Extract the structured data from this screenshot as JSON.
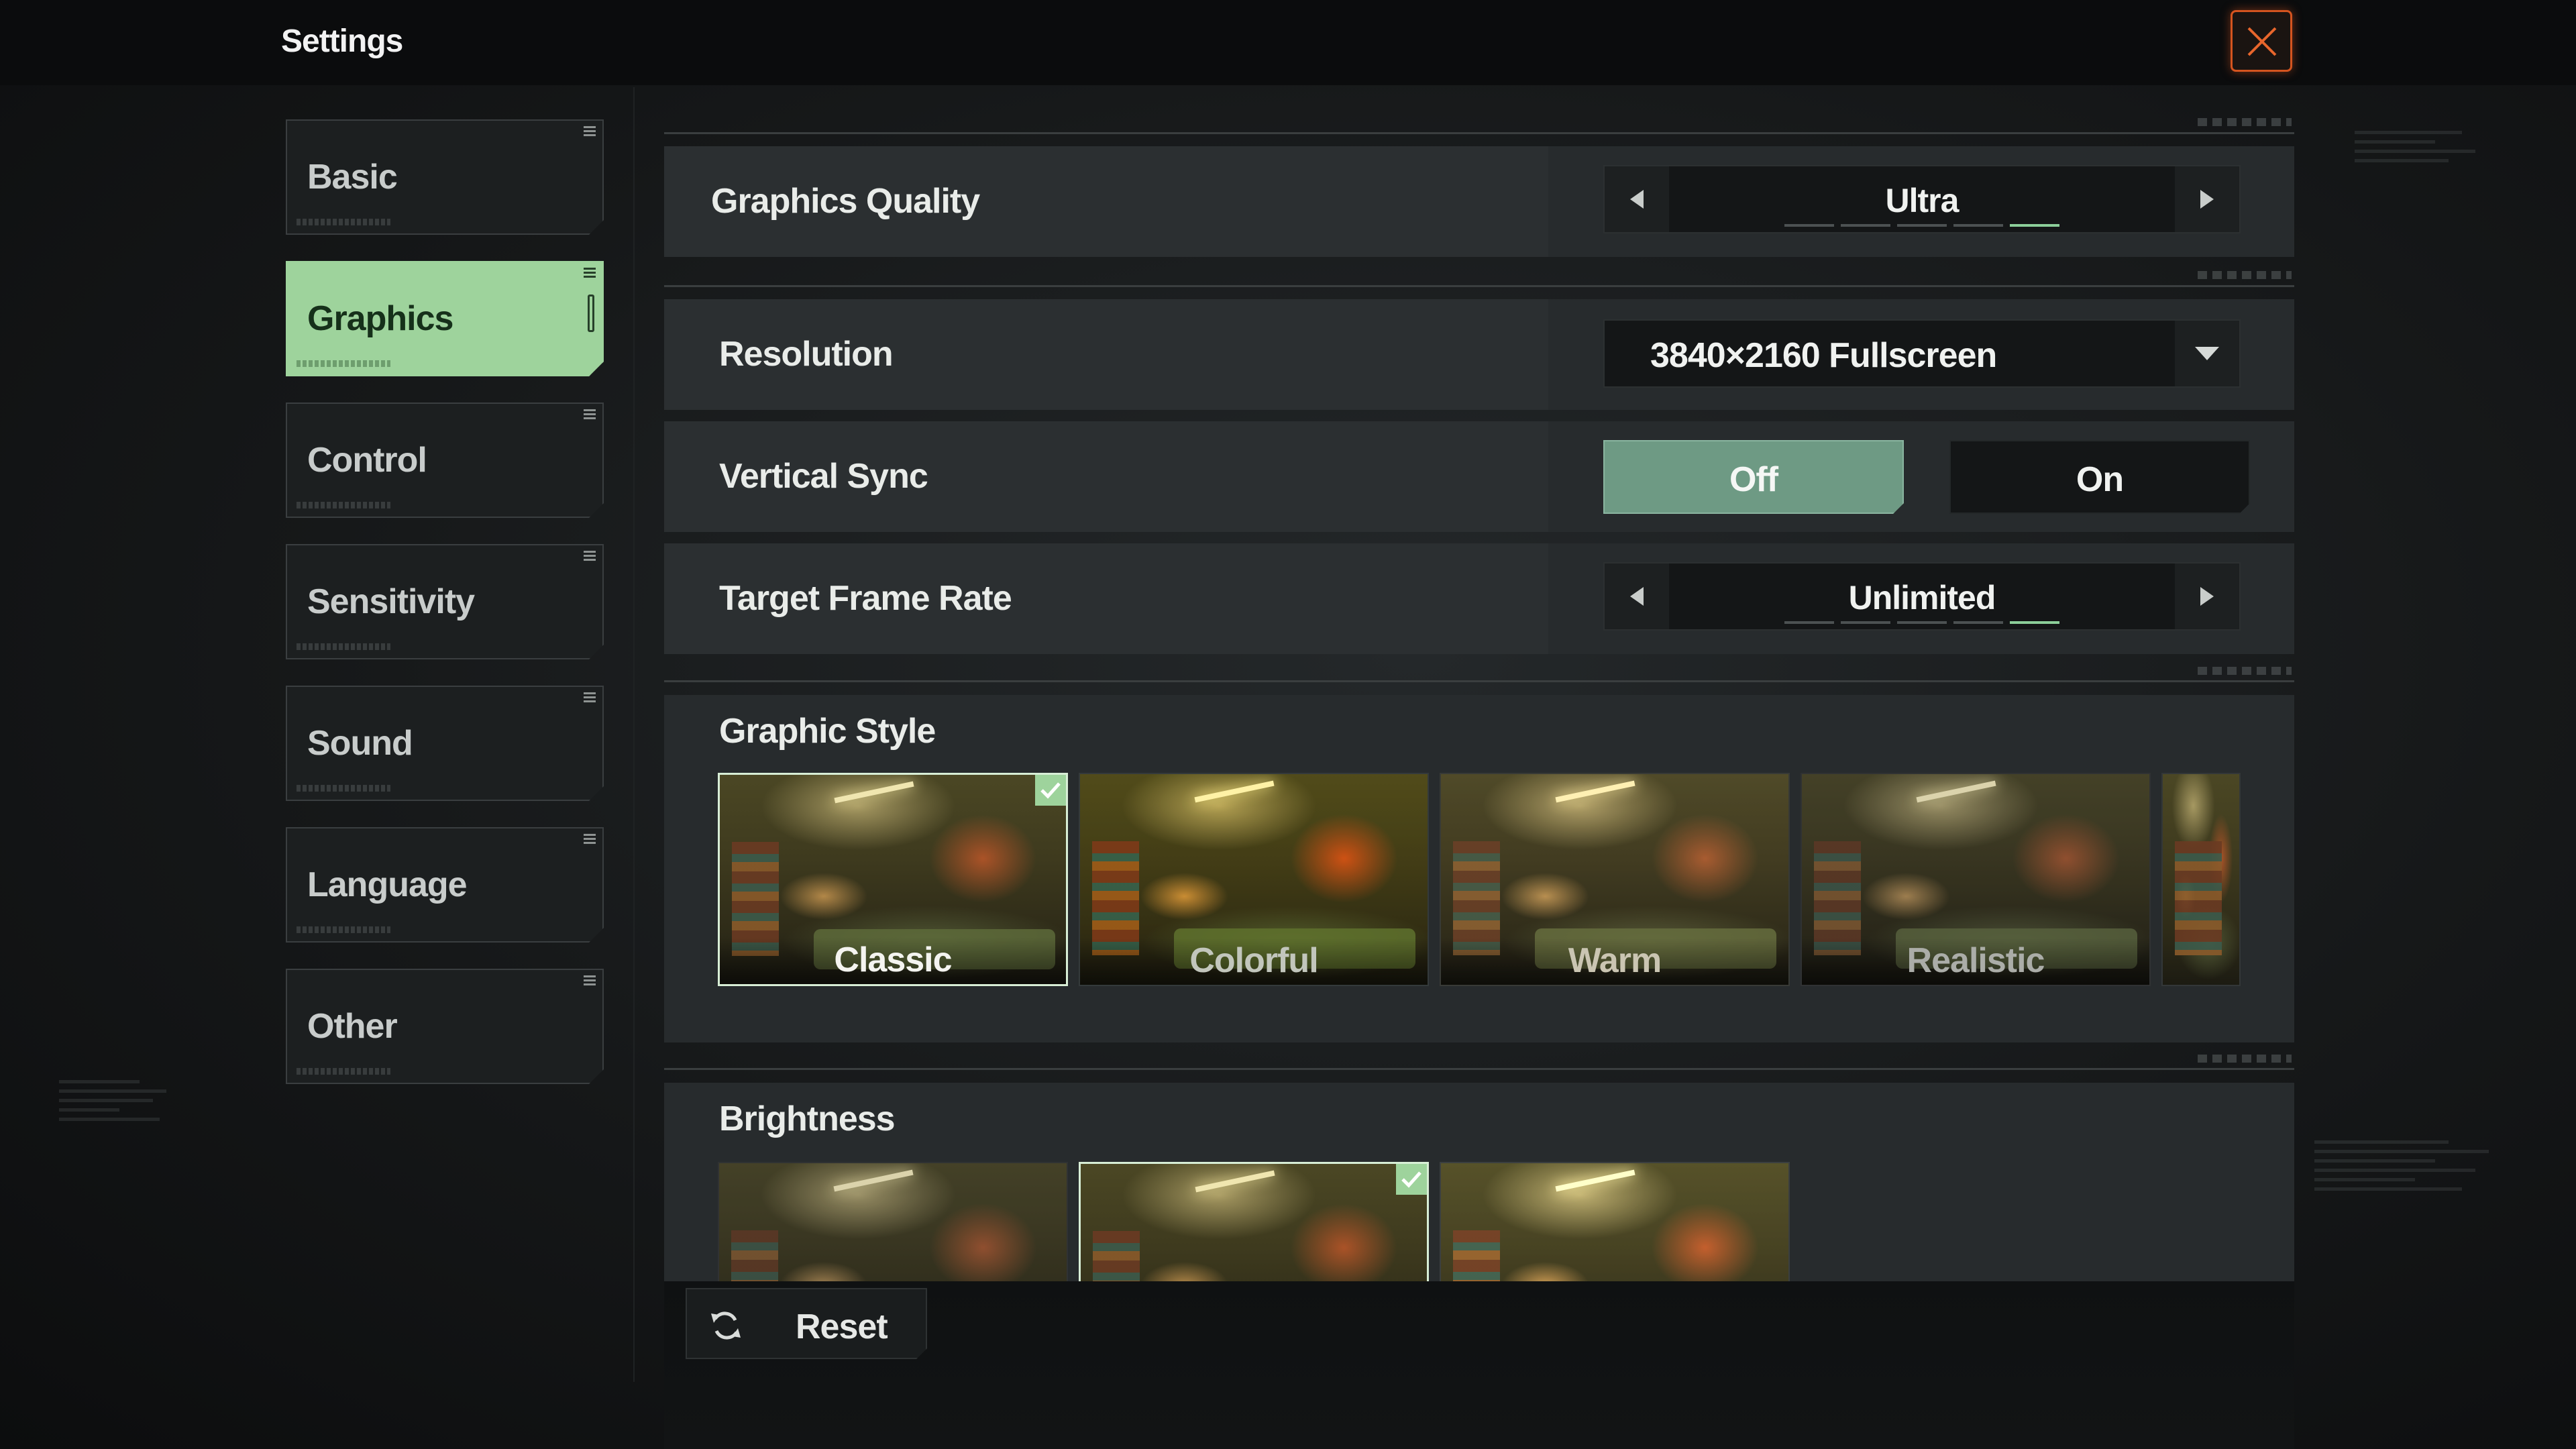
{
  "header": {
    "title": "Settings",
    "close_icon": "close-x-icon",
    "accent_color": "#d4541f"
  },
  "sidebar": {
    "items": [
      {
        "label": "Basic",
        "active": false
      },
      {
        "label": "Graphics",
        "active": true
      },
      {
        "label": "Control",
        "active": false
      },
      {
        "label": "Sensitivity",
        "active": false
      },
      {
        "label": "Sound",
        "active": false
      },
      {
        "label": "Language",
        "active": false
      },
      {
        "label": "Other",
        "active": false
      }
    ],
    "active_color": "#9ed39c"
  },
  "settings": {
    "graphics_quality": {
      "label": "Graphics Quality",
      "value": "Ultra",
      "level_count": 5,
      "selected_level": 5
    },
    "resolution": {
      "label": "Resolution",
      "value": "3840×2160  Fullscreen"
    },
    "vertical_sync": {
      "label": "Vertical Sync",
      "options": [
        "Off",
        "On"
      ],
      "selected": "Off"
    },
    "target_frame_rate": {
      "label": "Target Frame Rate",
      "value": "Unlimited",
      "level_count": 5,
      "selected_level": 5
    },
    "graphic_style": {
      "label": "Graphic Style",
      "options": [
        "Classic",
        "Colorful",
        "Warm",
        "Realistic"
      ],
      "selected": "Classic"
    },
    "brightness": {
      "label": "Brightness",
      "option_count": 3,
      "selected_index": 2
    }
  },
  "footer": {
    "reset_label": "Reset",
    "reset_icon": "refresh-icon"
  }
}
